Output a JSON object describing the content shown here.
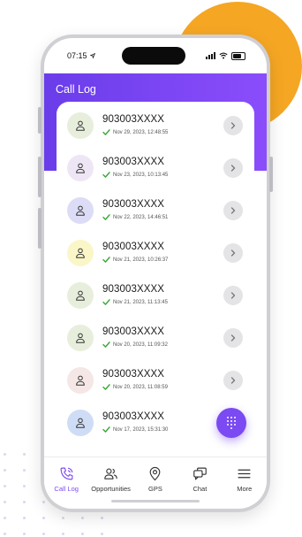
{
  "status_bar": {
    "time": "07:15",
    "location_icon": "location-arrow-icon",
    "icons": [
      "signal-icon",
      "wifi-icon",
      "battery-icon"
    ]
  },
  "header": {
    "title": "Call Log"
  },
  "call_log": {
    "items": [
      {
        "number": "903003XXXX",
        "timestamp": "Nov 29, 2023, 12:48:55",
        "avatar_color": "#e7efdc"
      },
      {
        "number": "903003XXXX",
        "timestamp": "Nov 23, 2023, 10:13:45",
        "avatar_color": "#efe6f5"
      },
      {
        "number": "903003XXXX",
        "timestamp": "Nov 22, 2023, 14:46:51",
        "avatar_color": "#dcdcf7"
      },
      {
        "number": "903003XXXX",
        "timestamp": "Nov 21, 2023, 10:26:37",
        "avatar_color": "#fbf6c8"
      },
      {
        "number": "903003XXXX",
        "timestamp": "Nov 21, 2023, 11:13:45",
        "avatar_color": "#e7efdc"
      },
      {
        "number": "903003XXXX",
        "timestamp": "Nov 20, 2023, 11:09:32",
        "avatar_color": "#e7efdc"
      },
      {
        "number": "903003XXXX",
        "timestamp": "Nov 20, 2023, 11:08:59",
        "avatar_color": "#f4e7e6"
      },
      {
        "number": "903003XXXX",
        "timestamp": "Nov 17, 2023, 15:31:30",
        "avatar_color": "#cfdcf5"
      }
    ]
  },
  "fab": {
    "icon": "dialpad-icon"
  },
  "tabbar": {
    "tabs": [
      {
        "label": "Call Log",
        "icon": "phone-call-icon",
        "active": true
      },
      {
        "label": "Opportunities",
        "icon": "users-icon",
        "active": false
      },
      {
        "label": "GPS",
        "icon": "map-pin-icon",
        "active": false
      },
      {
        "label": "Chat",
        "icon": "chat-icon",
        "active": false
      },
      {
        "label": "More",
        "icon": "menu-icon",
        "active": false
      }
    ]
  },
  "colors": {
    "accent": "#7b4af2",
    "header_start": "#6a3dea",
    "header_end": "#8b4dfb",
    "blob": "#F5A623",
    "check": "#3aa63a"
  }
}
